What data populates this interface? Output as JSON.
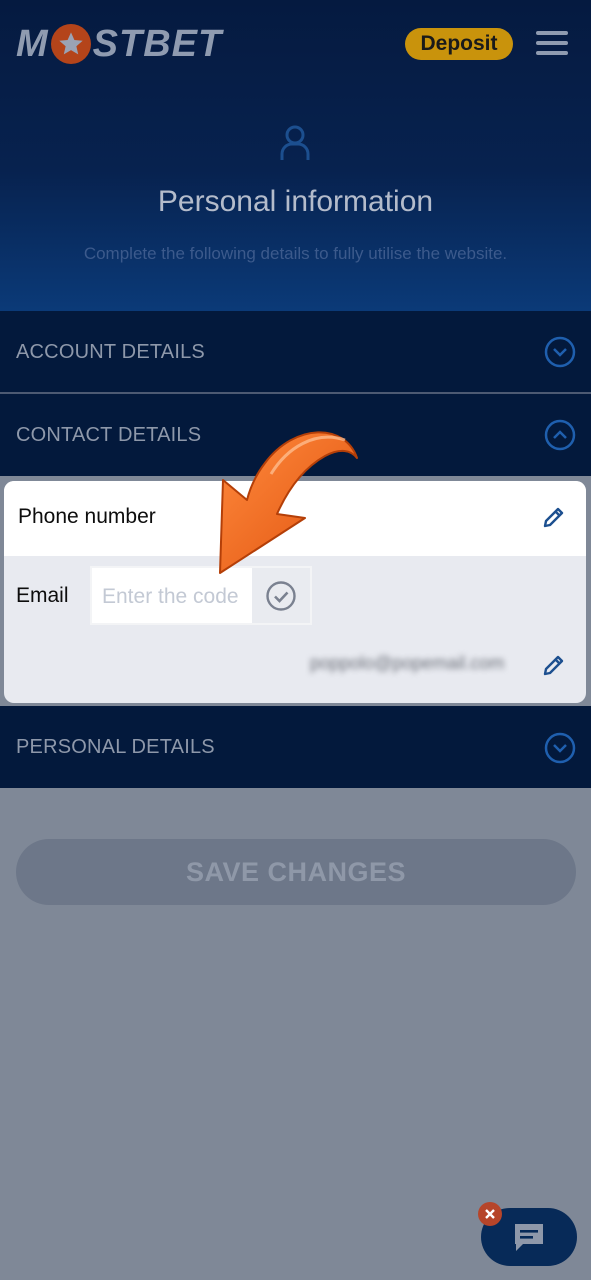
{
  "header": {
    "logo_left": "M",
    "logo_right": "STBET",
    "deposit_label": "Deposit"
  },
  "hero": {
    "title": "Personal information",
    "subtitle": "Complete the following details to fully utilise the website."
  },
  "sections": {
    "account": {
      "label": "ACCOUNT DETAILS",
      "expanded": false
    },
    "contact": {
      "label": "CONTACT DETAILS",
      "expanded": true
    },
    "personal": {
      "label": "PERSONAL DETAILS",
      "expanded": false
    }
  },
  "contact": {
    "phone_label": "Phone number",
    "email_label": "Email",
    "code_placeholder": "Enter the code",
    "email_value": "poppolo@popemail.com"
  },
  "save_label": "SAVE CHANGES",
  "icons": {
    "user": "user-icon",
    "menu": "hamburger-menu-icon",
    "chevron_down": "chevron-down-icon",
    "chevron_up": "chevron-up-icon",
    "edit": "pencil-icon",
    "check": "check-circle-icon",
    "chat": "chat-icon",
    "close": "close-icon",
    "arrow": "arrow-pointer-icon"
  },
  "colors": {
    "brand_navy": "#03193c",
    "deposit_yellow": "#c9930c",
    "accent_blue": "#1f5fae",
    "arrow_orange": "#f26a1b"
  }
}
